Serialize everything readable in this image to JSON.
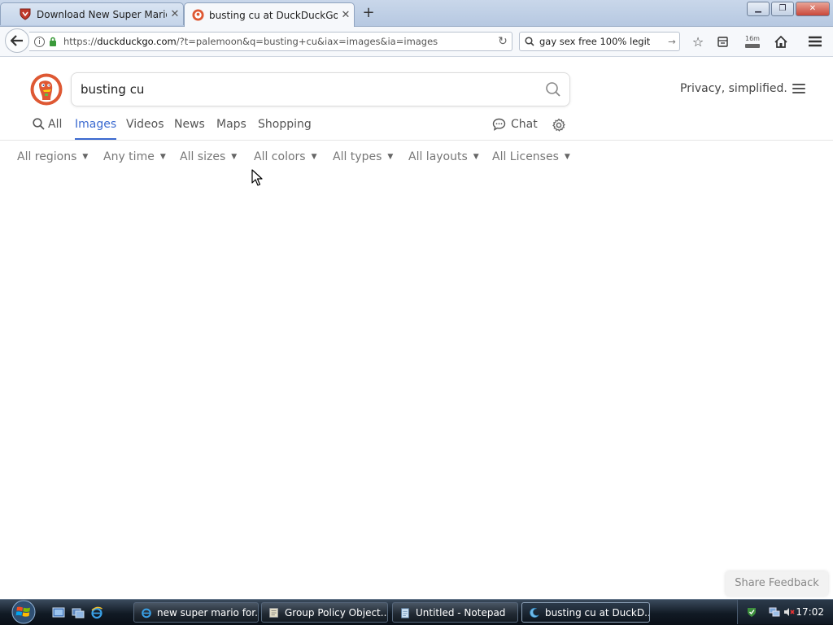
{
  "browser": {
    "tabs": [
      {
        "label": "Download New Super Mario",
        "icon": "shield-favicon-icon",
        "active": false
      },
      {
        "label": "busting cu at DuckDuckGo",
        "icon": "duckduckgo-favicon-icon",
        "active": true
      }
    ],
    "new_tab_glyph": "+",
    "url_prefix": "https://",
    "url_domain": "duckduckgo.com",
    "url_rest": "/?t=palemoon&q=busting+cu&iax=images&ia=images",
    "search_value": "gay sex free 100% legit",
    "downloads_badge": "16m"
  },
  "page": {
    "search_query": "busting cu",
    "tagline": "Privacy, simplified.",
    "tabs": [
      {
        "label": "All"
      },
      {
        "label": "Images"
      },
      {
        "label": "Videos"
      },
      {
        "label": "News"
      },
      {
        "label": "Maps"
      },
      {
        "label": "Shopping"
      }
    ],
    "chat_label": "Chat",
    "filters": [
      {
        "label": "All regions"
      },
      {
        "label": "Any time"
      },
      {
        "label": "All sizes"
      },
      {
        "label": "All colors"
      },
      {
        "label": "All types"
      },
      {
        "label": "All layouts"
      },
      {
        "label": "All Licenses"
      }
    ],
    "share_feedback": "Share Feedback",
    "accent_color": "#3b6ad0",
    "logo_color": "#de5833"
  },
  "taskbar": {
    "buttons": [
      {
        "label": "new super mario for..."
      },
      {
        "label": "Group Policy Object..."
      },
      {
        "label": "Untitled - Notepad"
      },
      {
        "label": "busting cu at DuckD..."
      }
    ],
    "clock": "17:02"
  }
}
